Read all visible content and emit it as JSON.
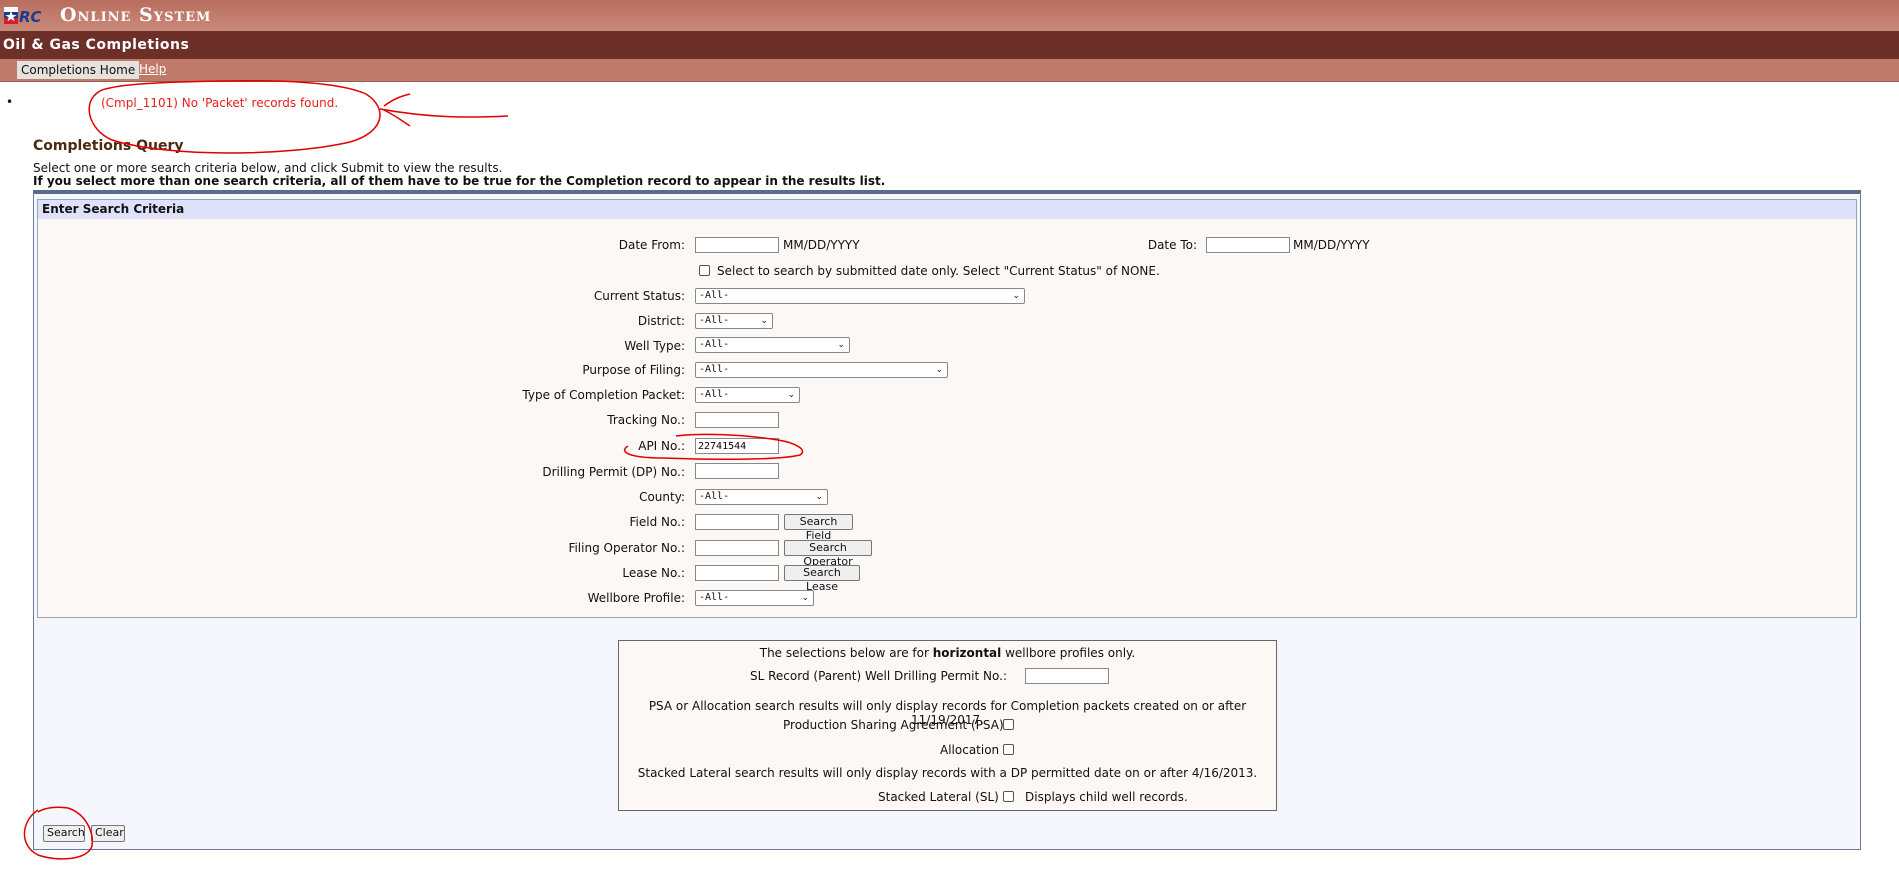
{
  "header": {
    "logo_text": "RRC",
    "system_title": "Online System",
    "app_title": "Oil & Gas Completions"
  },
  "nav": {
    "home_label": "Completions Home",
    "help_label": "Help"
  },
  "message": {
    "text": "(Cmpl_1101) No 'Packet' records found."
  },
  "query": {
    "title": "Completions Query",
    "description": "Select one or more search criteria below, and click Submit to view the results.",
    "warning": "If you select more than one search criteria, all of them have to be true for the Completion record to appear in the results list."
  },
  "criteria": {
    "header": "Enter Search Criteria",
    "date_from_label": "Date From:",
    "date_to_label": "Date To:",
    "date_format": "MM/DD/YYYY",
    "submitted_only_text": "Select to search by submitted date only. Select \"Current Status\" of NONE.",
    "current_status_label": "Current Status:",
    "district_label": "District:",
    "well_type_label": "Well Type:",
    "purpose_label": "Purpose of Filing:",
    "packet_type_label": "Type of Completion Packet:",
    "tracking_label": "Tracking No.:",
    "api_label": "API No.:",
    "api_value": "22741544",
    "dp_label": "Drilling Permit (DP) No.:",
    "county_label": "County:",
    "field_label": "Field No.:",
    "operator_label": "Filing Operator No.:",
    "lease_label": "Lease No.:",
    "wellbore_label": "Wellbore Profile:",
    "select_all": "-All-",
    "search_field_btn": "Search Field",
    "search_operator_btn": "Search Operator",
    "search_lease_btn": "Search Lease"
  },
  "horizontal": {
    "intro_prefix": "The selections below are for ",
    "intro_bold": "horizontal",
    "intro_suffix": " wellbore profiles only.",
    "sl_parent_label": "SL Record (Parent) Well Drilling Permit No.:",
    "psa_note": "PSA or Allocation search results will only display records for Completion packets created on or after 11/19/2017.",
    "psa_label": "Production Sharing Agreement (PSA)",
    "allocation_label": "Allocation",
    "stacked_note": "Stacked Lateral search results will only display records with a DP permitted date on or after 4/16/2013.",
    "stacked_label": "Stacked Lateral (SL)",
    "stacked_suffix": "Displays child well records."
  },
  "actions": {
    "search_label": "Search",
    "clear_label": "Clear"
  },
  "colors": {
    "banner": "#b86d5d",
    "app_bar": "#6d3028",
    "nav_bar": "#c07a6a",
    "error_text": "#e81e1e",
    "annotation": "#e00000"
  }
}
